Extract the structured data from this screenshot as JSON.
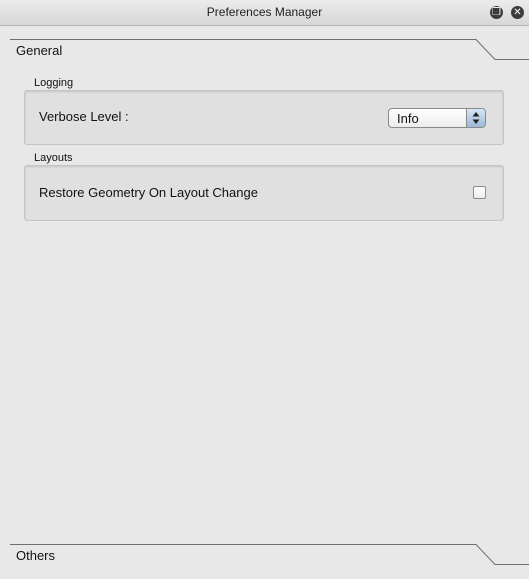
{
  "window": {
    "title": "Preferences Manager",
    "buttons": {
      "float_icon": "restore-window-icon",
      "float_glyph": "❐",
      "close_icon": "close-icon",
      "close_glyph": "✕"
    }
  },
  "sections": {
    "general": {
      "label": "General",
      "groups": {
        "logging": {
          "title": "Logging",
          "verbose_label": "Verbose Level :",
          "verbose_value": "Info"
        },
        "layouts": {
          "title": "Layouts",
          "restore_label": "Restore Geometry On Layout Change",
          "restore_checked": false
        }
      }
    },
    "others": {
      "label": "Others"
    }
  },
  "colors": {
    "background": "#e8e8e8",
    "select_arrow_accent": "#9cb7d8"
  }
}
